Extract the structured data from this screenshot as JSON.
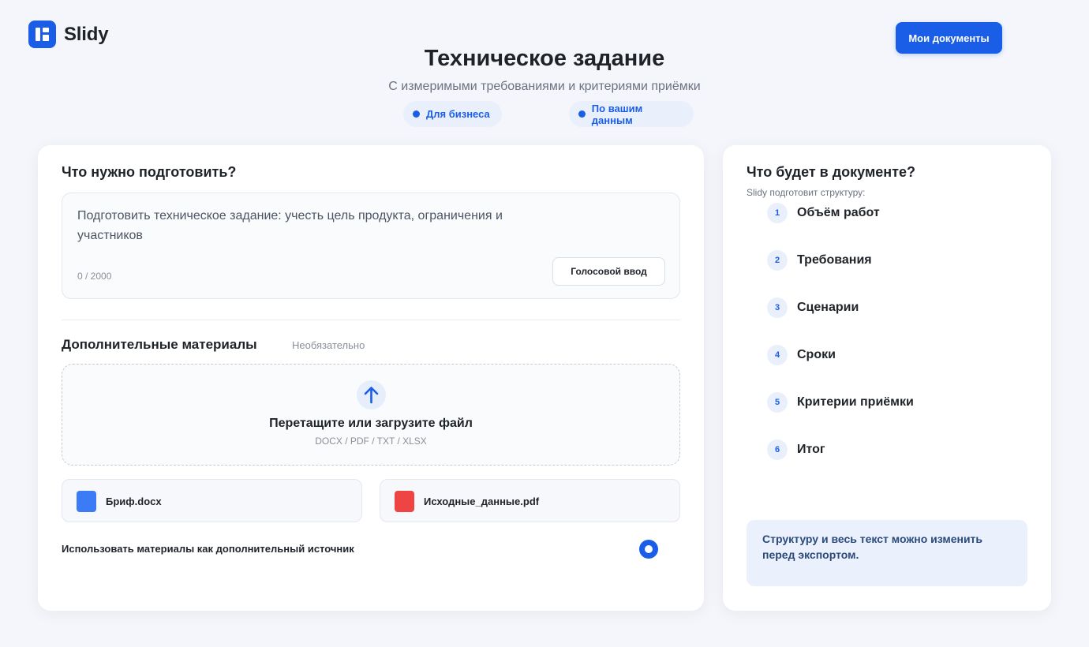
{
  "app": {
    "name": "Slidy",
    "logo_icon": "slidy-logo-icon",
    "my_docs_label": "Мои документы"
  },
  "colors": {
    "accent": "#1a5ee8",
    "background": "#f4f6fb",
    "file_docx": "#3b7bf6",
    "file_pdf": "#ef4444"
  },
  "header": {
    "title": "Техническое задание",
    "subtitle": "С измеримыми требованиями и критериями приёмки",
    "pills": [
      "Для бизнеса",
      "По вашим данным"
    ]
  },
  "main": {
    "prompt_title": "Что нужно подготовить?",
    "prompt_text": "Подготовить техническое задание: учесть цель продукта, ограничения и участников",
    "char_count": "0 / 2000",
    "voice_label": "Голосовой ввод",
    "extra_title": "Дополнительные материалы",
    "optional_label": "Необязательно",
    "dropzone": {
      "title": "Перетащите или загрузите файл",
      "formats": "DOCX / PDF / TXT / XLSX",
      "icon": "upload-arrow-icon"
    },
    "files": [
      {
        "name": "Бриф.docx",
        "icon": "docx-file-icon"
      },
      {
        "name": "Исходные_данные.pdf",
        "icon": "pdf-file-icon"
      }
    ],
    "use_materials_label": "Использовать материалы как дополнительный источник",
    "use_materials_selected": true
  },
  "sidebar": {
    "title": "Что будет в документе?",
    "subtitle": "Slidy подготовит структуру:",
    "items": [
      {
        "num": "1",
        "label": "Объём работ"
      },
      {
        "num": "2",
        "label": "Требования"
      },
      {
        "num": "3",
        "label": "Сценарии"
      },
      {
        "num": "4",
        "label": "Сроки"
      },
      {
        "num": "5",
        "label": "Критерии приёмки"
      },
      {
        "num": "6",
        "label": "Итог"
      }
    ],
    "note": "Структуру и весь текст можно изменить перед экспортом."
  }
}
